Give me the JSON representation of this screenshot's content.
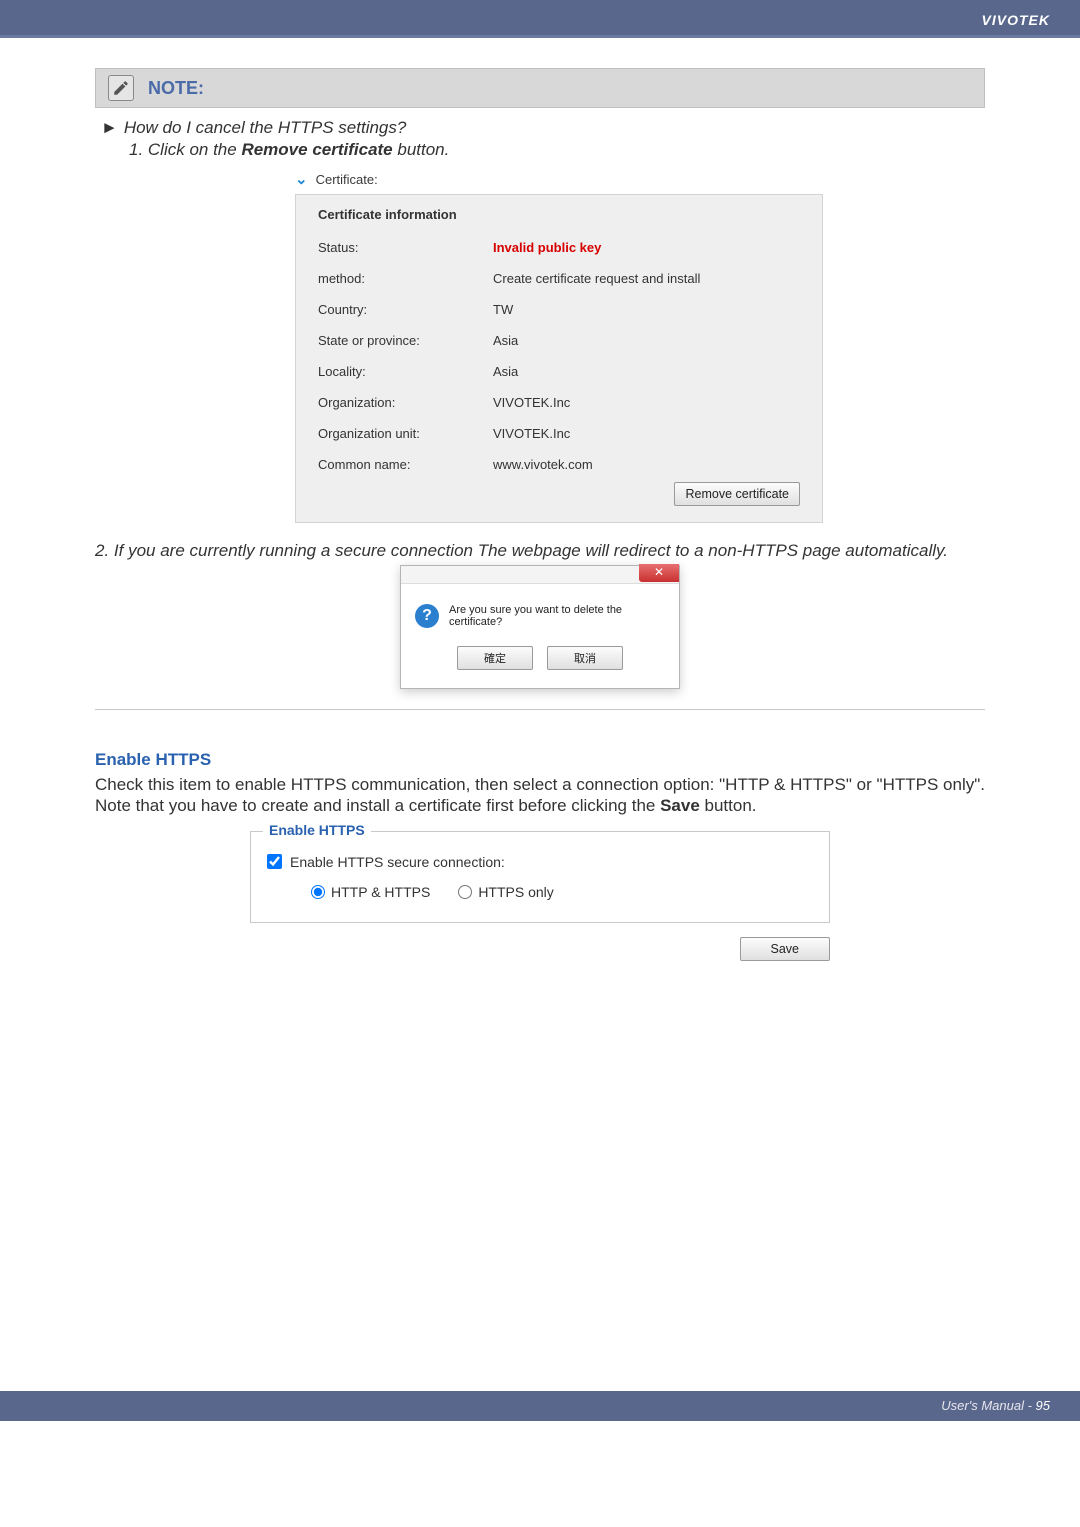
{
  "header": {
    "brand": "VIVOTEK"
  },
  "note": {
    "title": "NOTE:",
    "question": "How do I cancel the HTTPS settings?",
    "step1_prefix": "1. Click on the ",
    "step1_bold": "Remove certificate",
    "step1_suffix": " button."
  },
  "certificate": {
    "expand_label": "Certificate:",
    "info_title": "Certificate information",
    "rows": [
      {
        "key": "Status:",
        "val": "Invalid public key",
        "red": true
      },
      {
        "key": "method:",
        "val": "Create certificate request and install"
      },
      {
        "key": "Country:",
        "val": "TW"
      },
      {
        "key": "State or province:",
        "val": "Asia"
      },
      {
        "key": "Locality:",
        "val": "Asia"
      },
      {
        "key": "Organization:",
        "val": "VIVOTEK.Inc"
      },
      {
        "key": "Organization unit:",
        "val": "VIVOTEK.Inc"
      },
      {
        "key": "Common name:",
        "val": "www.vivotek.com"
      }
    ],
    "remove_btn": "Remove certificate"
  },
  "step2": "2. If you are currently running a secure connection The webpage will redirect to a non-HTTPS page automatically.",
  "dialog": {
    "message": "Are you sure you want to delete the certificate?",
    "ok": "確定",
    "cancel": "取消"
  },
  "enable_section": {
    "heading": "Enable HTTPS",
    "body_prefix": "Check this item to enable HTTPS communication, then select a connection option: \"HTTP & HTTPS\" or \"HTTPS only\". Note that you have to create and install a certificate first before clicking the ",
    "body_bold": "Save",
    "body_suffix": " button."
  },
  "enable_panel": {
    "legend": "Enable HTTPS",
    "checkbox_label": "Enable HTTPS secure connection:",
    "radio1": "HTTP & HTTPS",
    "radio2": "HTTPS only",
    "save_btn": "Save"
  },
  "footer": {
    "manual": "User's Manual - ",
    "page": "95"
  }
}
